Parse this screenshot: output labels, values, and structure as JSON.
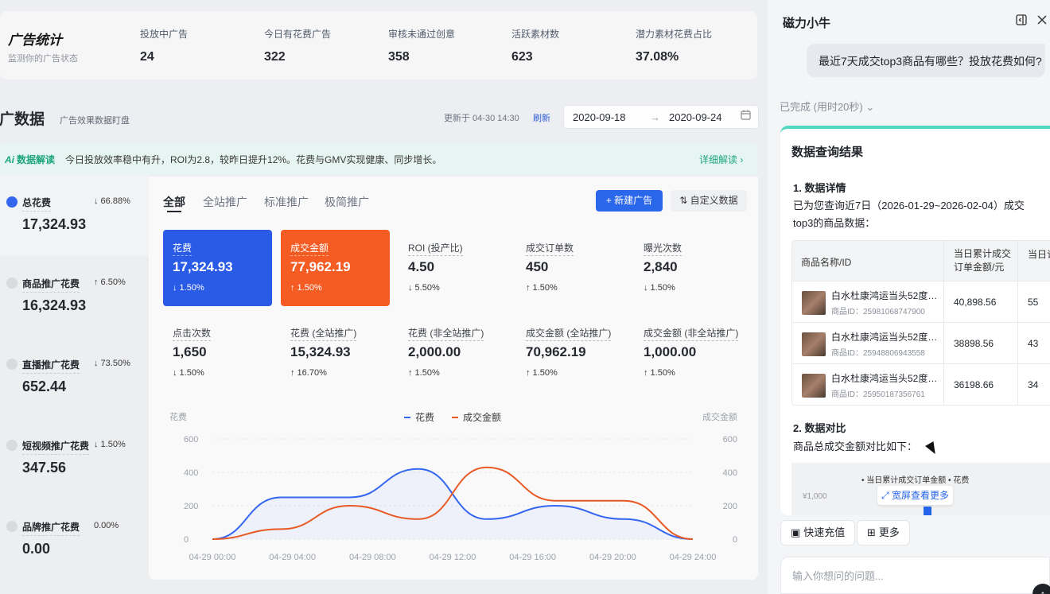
{
  "header": {
    "brand_title": "广告统计",
    "brand_subtitle": "监测你的广告状态",
    "stats": [
      {
        "label": "投放中广告",
        "value": "24"
      },
      {
        "label": "今日有花费广告",
        "value": "322"
      },
      {
        "label": "审核未通过创意",
        "value": "358"
      },
      {
        "label": "活跃素材数",
        "value": "623"
      },
      {
        "label": "潜力素材花费占比",
        "value": "37.08%"
      }
    ]
  },
  "section": {
    "title": "推广数据",
    "title_visible": "推广数据",
    "subtitle": "广告效果数据盯盘",
    "updated": "更新于 04-30 14:30",
    "refresh": "刷新",
    "date_start": "2020-09-18",
    "date_arrow": "→",
    "date_end": "2020-09-24"
  },
  "banner": {
    "tag": "数据解读",
    "text": "今日投放效率稳中有升，ROI为2.8，较昨日提升12%。花费与GMV实现健康、同步增长。",
    "more": "详细解读 ›"
  },
  "left_items": [
    {
      "name": "总花费",
      "change": "↓ 66.88%",
      "value": "17,324.93",
      "dir": "down",
      "color": "#2e62f0"
    },
    {
      "name": "商品推广花费",
      "change": "↑ 6.50%",
      "value": "16,324.93",
      "dir": "up",
      "color": "#d8dadd"
    },
    {
      "name": "直播推广花费",
      "change": "↓ 73.50%",
      "value": "652.44",
      "dir": "down",
      "color": "#d8dadd"
    },
    {
      "name": "短视频推广花费",
      "change": "↓ 1.50%",
      "value": "347.56",
      "dir": "down",
      "color": "#d8dadd"
    },
    {
      "name": "品牌推广花费",
      "change": "0.00%",
      "value": "0.00",
      "dir": "none",
      "color": "#d8dadd"
    }
  ],
  "tabs": [
    "全部",
    "全站推广",
    "标准推广",
    "极简推广"
  ],
  "buttons": {
    "new_ad": "+ 新建广告",
    "custom": "⇅ 自定义数据"
  },
  "metrics": [
    {
      "title": "花费",
      "value": "17,324.93",
      "change": "↓ 1.50%",
      "style": "blue",
      "dir": "down"
    },
    {
      "title": "成交金额",
      "value": "77,962.19",
      "change": "↑ 1.50%",
      "style": "orange",
      "dir": "up"
    },
    {
      "title": "ROI (投产比)",
      "value": "4.50",
      "change": "↓ 5.50%",
      "style": "plain",
      "dir": "down"
    },
    {
      "title": "成交订单数",
      "value": "450",
      "change": "↑ 1.50%",
      "style": "plain",
      "dir": "up"
    },
    {
      "title": "曝光次数",
      "value": "2,840",
      "change": "↓ 1.50%",
      "style": "plain",
      "dir": "down"
    },
    {
      "title": "点击次数",
      "value": "1,650",
      "change": "↓ 1.50%",
      "style": "plain",
      "dir": "down"
    },
    {
      "title": "花费 (全站推广)",
      "value": "15,324.93",
      "change": "↑ 16.70%",
      "style": "plain",
      "dir": "up"
    },
    {
      "title": "花费 (非全站推广)",
      "value": "2,000.00",
      "change": "↑ 1.50%",
      "style": "plain",
      "dir": "up"
    },
    {
      "title": "成交金额 (全站推广)",
      "value": "70,962.19",
      "change": "↑ 1.50%",
      "style": "plain",
      "dir": "up"
    },
    {
      "title": "成交金额 (非全站推广)",
      "value": "1,000.00",
      "change": "↑ 1.50%",
      "style": "plain",
      "dir": "up"
    }
  ],
  "chart_data": {
    "type": "line",
    "ylabel_left": "花费",
    "ylabel_right": "成交金额",
    "ylim": [
      0,
      600
    ],
    "yticks": [
      "0",
      "200",
      "400",
      "600"
    ],
    "x": [
      "04-29 00:00",
      "04-29 04:00",
      "04-29 08:00",
      "04-29 12:00",
      "04-29 16:00",
      "04-29 20:00",
      "04-29 24:00"
    ],
    "series": [
      {
        "name": "花费",
        "color": "#2e62f0",
        "values": [
          0,
          250,
          250,
          420,
          120,
          200,
          120,
          0
        ]
      },
      {
        "name": "成交金额",
        "color": "#e8561f",
        "values": [
          0,
          60,
          200,
          120,
          430,
          230,
          230,
          0
        ]
      }
    ],
    "grid": true,
    "legend": "top-center"
  },
  "assistant": {
    "title": "磁力小牛",
    "question": "最近7天成交top3商品有哪些？投放花费如何?",
    "status": "已完成 (用时20秒) ⌄",
    "result_title": "数据查询结果",
    "s1_title": "1. 数据详情",
    "s1_text": "已为您查询近7日（2026-01-29~2026-02-04）成交top3的商品数据：",
    "table_headers": [
      "商品名称/ID",
      "当日累计成交订单金额/元",
      "当日订"
    ],
    "table_rows": [
      {
        "name": "白水杜康鸿运当头52度…",
        "id": "商品ID：25981068747900",
        "amount": "40,898.56",
        "extra": "55"
      },
      {
        "name": "白水杜康鸿运当头52度…",
        "id": "商品ID：25948806943558",
        "amount": "38898.56",
        "extra": "43"
      },
      {
        "name": "白水杜康鸿运当头52度…",
        "id": "商品ID：25950187356761",
        "amount": "36198.66",
        "extra": "34"
      }
    ],
    "s2_title": "2. 数据对比",
    "s2_text": "商品总成交金额对比如下：",
    "mini_legend": "• 当日累计成交订单金额  • 花费",
    "mini_y": "¥1,000",
    "zoom": "⤢ 宽屏查看更多",
    "chip1": "快速充值",
    "chip2": "更多",
    "input_placeholder": "输入你想问的问题..."
  }
}
